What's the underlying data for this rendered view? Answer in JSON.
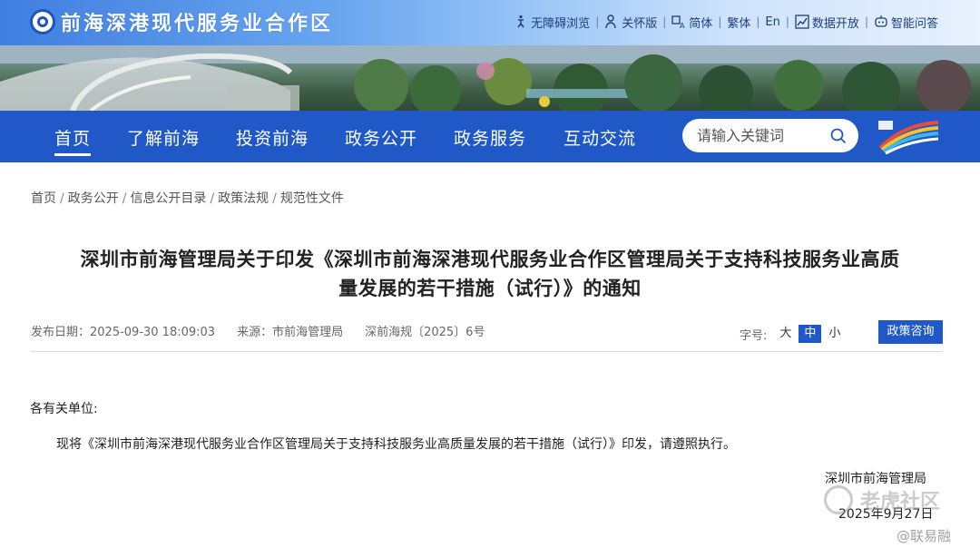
{
  "header": {
    "site_name": "前海深港现代服务业合作区",
    "utilities": [
      {
        "label": "无障碍浏览",
        "icon": "accessibility-icon"
      },
      {
        "label": "关怀版",
        "icon": "care-mode-icon"
      },
      {
        "label": "简体",
        "icon": "language-icon"
      },
      {
        "label": "繁体"
      },
      {
        "label": "En"
      },
      {
        "label": "数据开放",
        "icon": "chart-icon"
      },
      {
        "label": "智能问答",
        "icon": "robot-icon"
      }
    ]
  },
  "nav": {
    "items": [
      "首页",
      "了解前海",
      "投资前海",
      "政务公开",
      "政务服务",
      "互动交流"
    ],
    "active_index": 0,
    "search_placeholder": "请输入关键词"
  },
  "breadcrumb": [
    "首页",
    "政务公开",
    "信息公开目录",
    "政策法规",
    "规范性文件"
  ],
  "article": {
    "title_line1": "深圳市前海管理局关于印发《深圳市前海深港现代服务业合作区管理局关于支持科技服务业高质",
    "title_line2": "量发展的若干措施（试行）》的通知",
    "publish_date": "发布日期：2025-09-30 18:09:03",
    "source": "来源：市前海管理局",
    "doc_number": "深前海规〔2025〕6号",
    "font_size_label": "字号:",
    "font_sizes": [
      "大",
      "中",
      "小"
    ],
    "font_size_active": 1,
    "consult_button": "政策咨询",
    "salutation": "各有关单位:",
    "body": "现将《深圳市前海深港现代服务业合作区管理局关于支持科技服务业高质量发展的若干措施（试行）》印发，请遵照执行。",
    "sign_org": "深圳市前海管理局",
    "sign_date": "2025年9月27日"
  },
  "watermarks": {
    "community": "老虎社区",
    "source": "@联易融"
  },
  "colors": {
    "nav_blue": "#2058c8",
    "topbar_start": "#3f7fe0",
    "topbar_end": "#e8f1fd"
  }
}
